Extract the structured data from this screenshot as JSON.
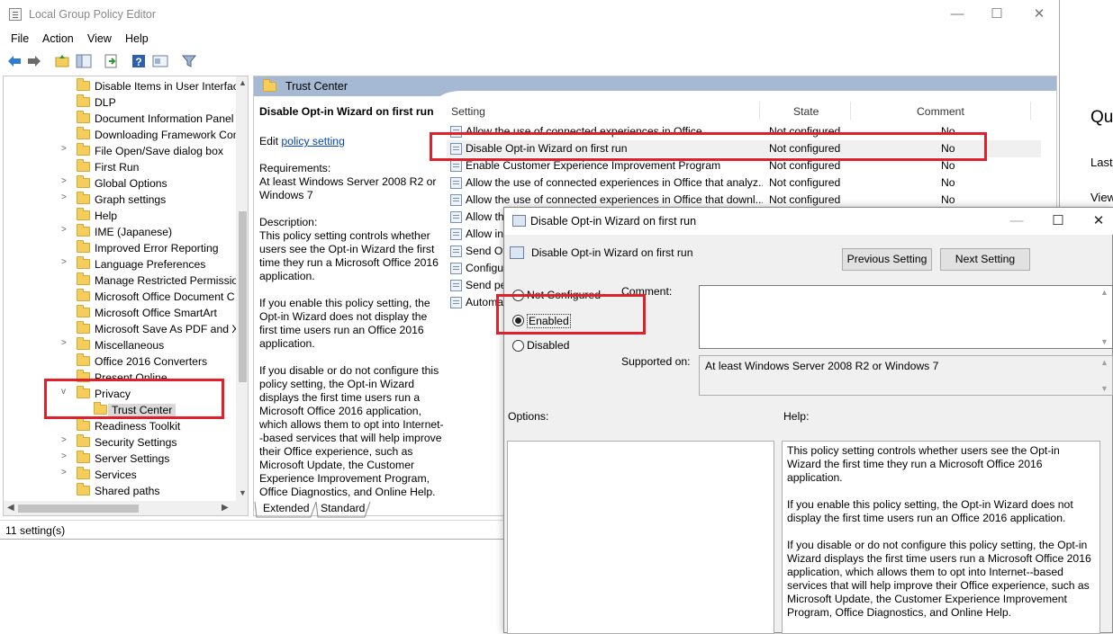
{
  "window": {
    "title": "Local Group Policy Editor",
    "min_glyph": "—",
    "max_glyph": "☐",
    "close_glyph": "✕"
  },
  "menu": [
    "File",
    "Action",
    "View",
    "Help"
  ],
  "background_window": {
    "heading": "Qu",
    "line1": "Last",
    "line2": "View"
  },
  "tree": {
    "items": [
      {
        "label": "Disable Items in User Interfac",
        "expander": ""
      },
      {
        "label": "DLP",
        "expander": ""
      },
      {
        "label": "Document Information Panel",
        "expander": ""
      },
      {
        "label": "Downloading Framework Com",
        "expander": ""
      },
      {
        "label": "File Open/Save dialog box",
        "expander": ">"
      },
      {
        "label": "First Run",
        "expander": ""
      },
      {
        "label": "Global Options",
        "expander": ">"
      },
      {
        "label": "Graph settings",
        "expander": ">"
      },
      {
        "label": "Help",
        "expander": ""
      },
      {
        "label": "IME (Japanese)",
        "expander": ">"
      },
      {
        "label": "Improved Error Reporting",
        "expander": ""
      },
      {
        "label": "Language Preferences",
        "expander": ">"
      },
      {
        "label": "Manage Restricted Permissio",
        "expander": ""
      },
      {
        "label": "Microsoft Office Document C",
        "expander": ""
      },
      {
        "label": "Microsoft Office SmartArt",
        "expander": ""
      },
      {
        "label": "Microsoft Save As PDF and XI",
        "expander": ""
      },
      {
        "label": "Miscellaneous",
        "expander": ">"
      },
      {
        "label": "Office 2016 Converters",
        "expander": ""
      },
      {
        "label": "Present Online",
        "expander": ""
      },
      {
        "label": "Privacy",
        "expander": "v"
      },
      {
        "label": "Trust Center",
        "expander": "",
        "child": true,
        "selected": true
      },
      {
        "label": "Readiness Toolkit",
        "expander": ""
      },
      {
        "label": "Security Settings",
        "expander": ">"
      },
      {
        "label": "Server Settings",
        "expander": ">"
      },
      {
        "label": "Services",
        "expander": ">"
      },
      {
        "label": "Shared paths",
        "expander": ""
      }
    ]
  },
  "right_pane": {
    "header_title": "Trust Center",
    "description": {
      "title": "Disable Opt-in Wizard on first run",
      "edit_prefix": "Edit ",
      "edit_link": "policy setting",
      "requirements_label": "Requirements:",
      "requirements_value": "At least Windows Server 2008 R2 or Windows 7",
      "description_label": "Description:",
      "p1": "This policy setting controls whether users see the Opt-in Wizard the first time they run a Microsoft Office 2016 application.",
      "p2": "If you enable this policy setting, the Opt-in Wizard does not display the first time users run an Office 2016 application.",
      "p3": "If you disable or do not configure this policy setting, the Opt-in Wizard displays the first time users run a Microsoft Office 2016 application, which allows them to opt into Internet--based services that will help improve their Office experience, such as Microsoft Update, the Customer Experience Improvement Program, Office Diagnostics, and Online Help."
    },
    "columns": {
      "setting": "Setting",
      "state": "State",
      "comment": "Comment"
    },
    "rows": [
      {
        "setting": "Allow the use of connected experiences in Office",
        "state": "Not configured",
        "comment": "No"
      },
      {
        "setting": "Disable Opt-in Wizard on first run",
        "state": "Not configured",
        "comment": "No"
      },
      {
        "setting": "Enable Customer Experience Improvement Program",
        "state": "Not configured",
        "comment": "No"
      },
      {
        "setting": "Allow the use of connected experiences in Office that analyz...",
        "state": "Not configured",
        "comment": "No"
      },
      {
        "setting": "Allow the use of connected experiences in Office that downl...",
        "state": "Not configured",
        "comment": "No"
      },
      {
        "setting": "Allow th",
        "state": "",
        "comment": ""
      },
      {
        "setting": "Allow in",
        "state": "",
        "comment": ""
      },
      {
        "setting": "Send Of",
        "state": "",
        "comment": ""
      },
      {
        "setting": "Configu",
        "state": "",
        "comment": ""
      },
      {
        "setting": "Send pe",
        "state": "",
        "comment": ""
      },
      {
        "setting": "Automa",
        "state": "",
        "comment": ""
      }
    ],
    "tabs": [
      "Extended",
      "Standard"
    ]
  },
  "status": "11 setting(s)",
  "dialog": {
    "title": "Disable Opt-in Wizard on first run",
    "subtitle": "Disable Opt-in Wizard on first run",
    "prev_button": "Previous Setting",
    "next_button": "Next Setting",
    "radio_not_configured": "Not Configured",
    "radio_enabled": "Enabled",
    "radio_disabled": "Disabled",
    "comment_label": "Comment:",
    "supported_label": "Supported on:",
    "supported_value": "At least Windows Server 2008 R2 or Windows 7",
    "options_label": "Options:",
    "help_label": "Help:",
    "help_p1": "This policy setting controls whether users see the Opt-in Wizard the first time they run a Microsoft Office 2016 application.",
    "help_p2": "If you enable this policy setting, the Opt-in Wizard does not display the first time users run an Office 2016 application.",
    "help_p3": "If you disable or do not configure this policy setting, the Opt-in Wizard displays the first time users run a Microsoft Office 2016 application, which allows them to opt into Internet--based services that will help improve their Office experience, such as Microsoft Update, the Customer Experience Improvement Program, Office Diagnostics, and Online Help.",
    "selected_option": "Enabled"
  },
  "colors": {
    "highlight": "#e0202a",
    "header_band": "#a6b9d3",
    "folder": "#f4cd5c",
    "link": "#0645ad"
  }
}
